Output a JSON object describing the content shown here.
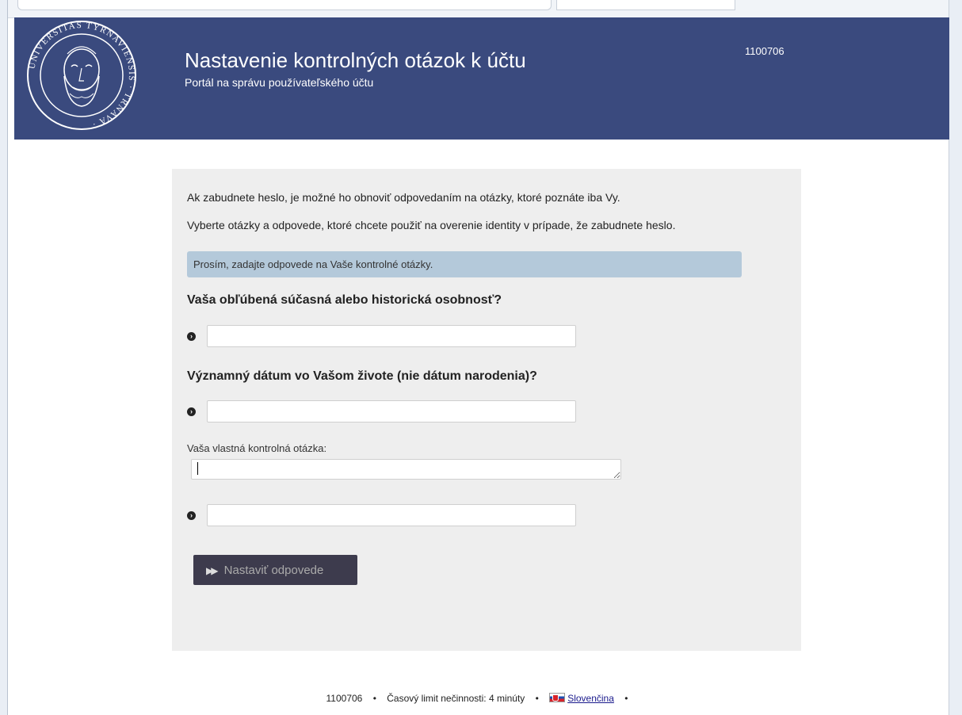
{
  "header": {
    "title": "Nastavenie kontrolných otázok k účtu",
    "subtitle": "Portál na správu používateľského účtu",
    "user_id": "1100706",
    "seal_text": "UNIVERSITAS TYRNAVIENSIS TRNAVA",
    "background": "#3a4a7e"
  },
  "panel": {
    "intro_1": "Ak zabudnete heslo, je možné ho obnoviť odpovedaním na otázky, ktoré poznáte iba Vy.",
    "intro_2": "Vyberte otázky a odpovede, ktoré chcete použiť na overenie identity v prípade, že zabudnete heslo.",
    "notice": "Prosím, zadajte odpovede na Vaše kontrolné otázky.",
    "question_1": "Vaša obľúbená súčasná alebo historická osobnosť?",
    "answer_1": "",
    "question_2": "Významný dátum vo Vašom živote (nie dátum narodenia)?",
    "answer_2": "",
    "custom_question_label": "Vaša vlastná kontrolná otázka:",
    "custom_question": "",
    "answer_3": "",
    "submit_label": "Nastaviť odpovede"
  },
  "footer": {
    "user_id": "1100706",
    "separator": "•",
    "inactivity": "Časový limit nečinnosti: 4 minúty",
    "language": "Slovenčina"
  }
}
